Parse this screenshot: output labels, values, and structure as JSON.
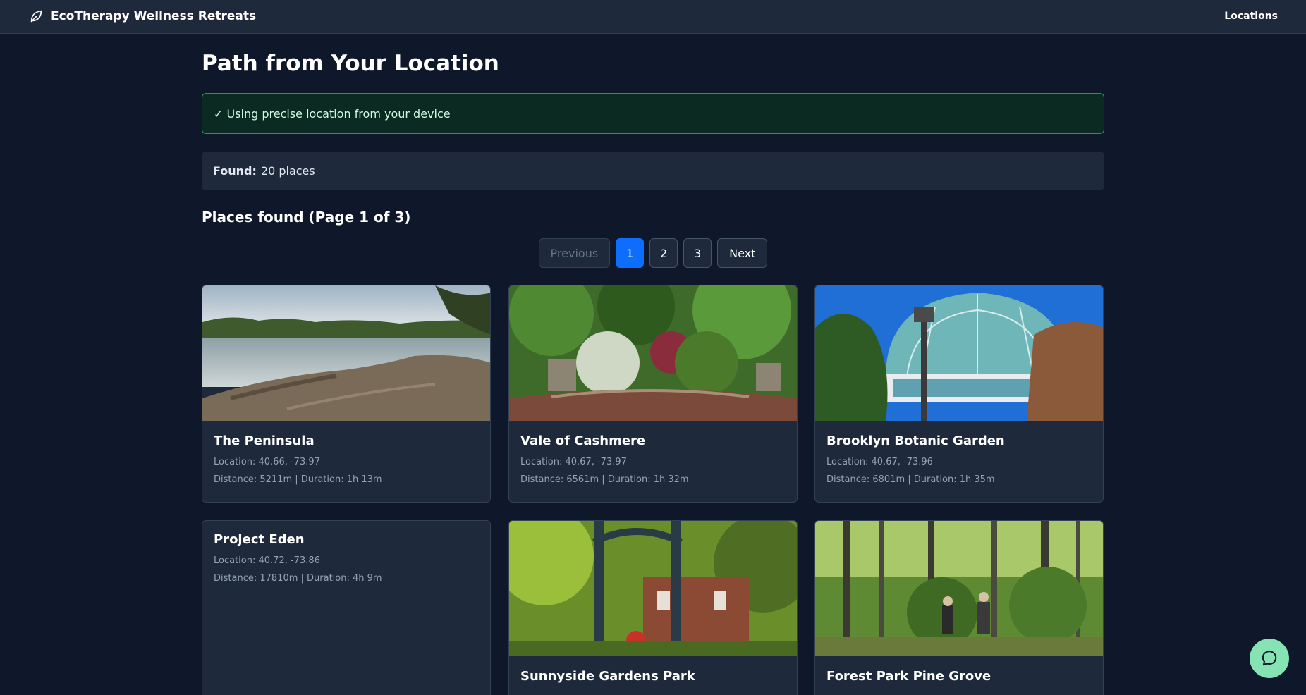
{
  "nav": {
    "brand": "EcoTherapy Wellness Retreats",
    "brand_icon": "leaf-icon",
    "links": [
      "Locations"
    ]
  },
  "page": {
    "title": "Path from Your Location",
    "alert": "✓ Using precise location from your device",
    "found_label": "Found:",
    "found_value": "20 places",
    "section_title": "Places found (Page 1 of 3)"
  },
  "pagination": {
    "previous": "Previous",
    "pages": [
      "1",
      "2",
      "3"
    ],
    "current": "1",
    "next": "Next"
  },
  "places": [
    {
      "name": "The Peninsula",
      "location": "Location: 40.66, -73.97",
      "distance": "Distance: 5211m | Duration: 1h 13m",
      "image": "lake-shore"
    },
    {
      "name": "Vale of Cashmere",
      "location": "Location: 40.67, -73.97",
      "distance": "Distance: 6561m | Duration: 1h 32m",
      "image": "garden-path"
    },
    {
      "name": "Brooklyn Botanic Garden",
      "location": "Location: 40.67, -73.96",
      "distance": "Distance: 6801m | Duration: 1h 35m",
      "image": "glass-conservatory"
    },
    {
      "name": "Project Eden",
      "location": "Location: 40.72, -73.86",
      "distance": "Distance: 17810m | Duration: 4h 9m",
      "image": ""
    },
    {
      "name": "Sunnyside Gardens Park",
      "location": "",
      "distance": "",
      "image": "park-gate"
    },
    {
      "name": "Forest Park Pine Grove",
      "location": "",
      "distance": "",
      "image": "pine-forest"
    }
  ],
  "chat_button_icon": "chat-bubble-icon",
  "colors": {
    "background": "#0f172a",
    "surface": "#1e293b",
    "accent": "#0d6efd",
    "success": "#16a34a",
    "fab": "#86e3b3"
  }
}
